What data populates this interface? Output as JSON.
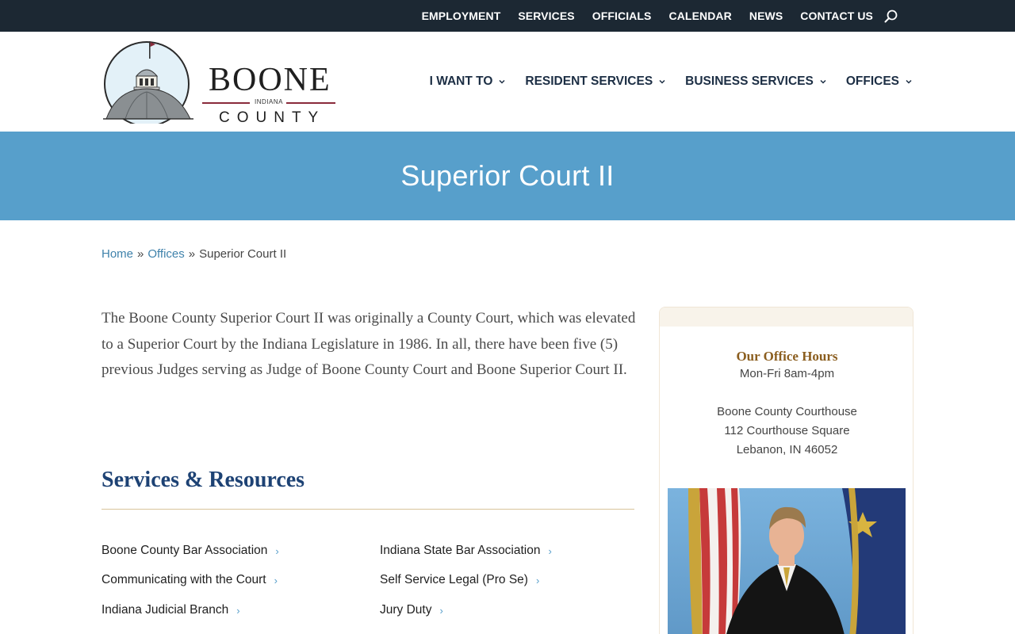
{
  "topbar": {
    "links": [
      "EMPLOYMENT",
      "SERVICES",
      "OFFICIALS",
      "CALENDAR",
      "NEWS",
      "CONTACT US"
    ],
    "search_icon": "search-icon"
  },
  "logo": {
    "name": "BOONE",
    "state": "INDIANA",
    "county": "COUNTY"
  },
  "main_nav": {
    "items": [
      "I WANT TO",
      "RESIDENT SERVICES",
      "BUSINESS SERVICES",
      "OFFICES"
    ]
  },
  "hero": {
    "title": "Superior Court II"
  },
  "breadcrumb": {
    "home": "Home",
    "offices": "Offices",
    "separator": "»",
    "current": "Superior Court II"
  },
  "intro": {
    "text": "The Boone County Superior Court II was originally a County Court, which was elevated to a Superior Court by the Indiana Legislature in 1986. In all, there have been five (5) previous Judges serving as Judge of Boone County Court and Boone Superior Court II."
  },
  "services": {
    "heading": "Services & Resources",
    "left": [
      "Boone County Bar Association",
      "Communicating with the Court",
      "Indiana Judicial Branch"
    ],
    "right": [
      "Indiana State Bar Association",
      "Self Service Legal (Pro Se)",
      "Jury Duty"
    ],
    "arrow": "›"
  },
  "sidebar": {
    "hours_title": "Our Office Hours",
    "hours": "Mon-Fri  8am-4pm",
    "address_name": "Boone County Courthouse",
    "address_street": "112 Courthouse Square",
    "address_city": "Lebanon, IN 46052"
  },
  "colors": {
    "topbar_bg": "#1c2833",
    "hero_bg": "#579fcb",
    "link": "#3f82ab",
    "heading_navy": "#1d4274",
    "gold": "#8b5e1f"
  }
}
